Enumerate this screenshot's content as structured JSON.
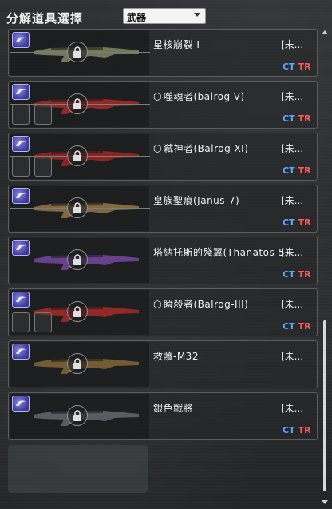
{
  "header": {
    "title": "分解道具選擇",
    "dropdown_value": "武器"
  },
  "items": [
    {
      "name": "星核崩裂 I",
      "prefix_icon": false,
      "status": "[未...",
      "ct": "CT",
      "tr": "TR",
      "slots": 0,
      "weapon_color": "#8a8f6a"
    },
    {
      "name": "噬魂者(balrog-V)",
      "prefix_icon": true,
      "status": "[未...",
      "ct": "CT",
      "tr": "TR",
      "slots": 2,
      "weapon_color": "#b02a2a"
    },
    {
      "name": "弒神者(Balrog-XI)",
      "prefix_icon": true,
      "status": "[未...",
      "ct": "CT",
      "tr": "TR",
      "slots": 2,
      "weapon_color": "#a82424"
    },
    {
      "name": "皇族聖痕(Janus-7)",
      "prefix_icon": false,
      "status": "[未...",
      "ct": "CT",
      "tr": "TR",
      "slots": 0,
      "weapon_color": "#9a7a4a"
    },
    {
      "name": "塔納托斯的殘翼(Thanatos-5)",
      "prefix_icon": false,
      "status": "[未...",
      "ct": "CT",
      "tr": "TR",
      "slots": 0,
      "weapon_color": "#7a4aa8"
    },
    {
      "name": "瞬殺者(Balrog-III)",
      "prefix_icon": true,
      "status": "[未...",
      "ct": "CT",
      "tr": "TR",
      "slots": 2,
      "weapon_color": "#b02a2a"
    },
    {
      "name": "救贖-M32",
      "prefix_icon": false,
      "status": "[未...",
      "ct": "",
      "tr": "",
      "slots": 0,
      "weapon_color": "#8a6a3a"
    },
    {
      "name": "銀色戰將",
      "prefix_icon": false,
      "status": "[未...",
      "ct": "CT",
      "tr": "TR",
      "slots": 0,
      "weapon_color": "#6a6c70"
    }
  ],
  "icons": {
    "grade": "grade-emblem-icon",
    "lock": "lock-icon",
    "prefix": "hexagon-icon"
  }
}
